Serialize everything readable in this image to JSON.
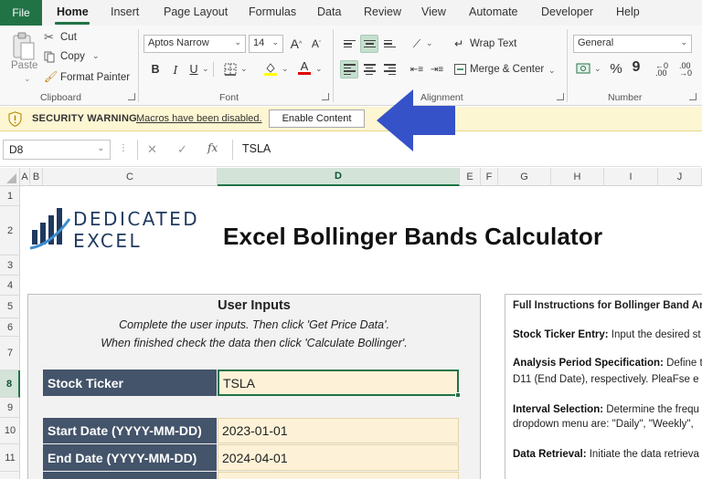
{
  "menu": {
    "file": "File",
    "tabs": [
      "Home",
      "Insert",
      "Page Layout",
      "Formulas",
      "Data",
      "Review",
      "View",
      "Automate",
      "Developer",
      "Help"
    ]
  },
  "ribbon": {
    "clipboard": {
      "paste": "Paste",
      "cut": "Cut",
      "copy": "Copy",
      "format_painter": "Format Painter",
      "label": "Clipboard"
    },
    "font": {
      "name": "Aptos Narrow",
      "size": "14",
      "bold": "B",
      "italic": "I",
      "underline": "U",
      "increase": "A",
      "decrease": "A",
      "label": "Font"
    },
    "alignment": {
      "wrap": "Wrap Text",
      "merge": "Merge & Center",
      "label": "Alignment"
    },
    "number": {
      "format": "General",
      "percent": "%",
      "comma": "9",
      "label": "Number"
    }
  },
  "security": {
    "title": "SECURITY WARNING",
    "message": "Macros have been disabled.",
    "button": "Enable Content"
  },
  "formula_bar": {
    "name_box": "D8",
    "fx": "fx",
    "content": "TSLA"
  },
  "columns": [
    "A",
    "B",
    "C",
    "D",
    "E",
    "F",
    "G",
    "H",
    "I",
    "J"
  ],
  "rows": [
    "1",
    "2",
    "3",
    "4",
    "5",
    "6",
    "7",
    "8",
    "9",
    "10",
    "11"
  ],
  "sheet": {
    "logo_line1": "DEDICATED",
    "logo_line2": "EXCEL",
    "title": "Excel Bollinger Bands Calculator",
    "inputs": {
      "title": "User Inputs",
      "sub1": "Complete the user inputs.  Then click 'Get Price Data'.",
      "sub2": "When finished check the data then click 'Calculate Bollinger'.",
      "fields": [
        {
          "label": "Stock Ticker",
          "value": "TSLA"
        },
        {
          "label": "Start Date (YYYY-MM-DD)",
          "value": "2023-01-01"
        },
        {
          "label": "End Date (YYYY-MM-DD)",
          "value": "2024-04-01"
        }
      ]
    },
    "instructions": {
      "header": "Full Instructions for Bollinger Band  An",
      "ticker_label": "Stock Ticker Entry:",
      "ticker_text": " Input the desired st",
      "period_label": "Analysis Period Specification:",
      "period_text": " Define t",
      "period_line2": "D11 (End Date), respectively. PleaFse e",
      "interval_label": "Interval Selection:",
      "interval_text": " Determine the frequ",
      "interval_line2": "dropdown menu are: \"Daily\", \"Weekly\",",
      "retrieval_label": "Data Retrieval:",
      "retrieval_text": " Initiate the data retrieva"
    }
  }
}
